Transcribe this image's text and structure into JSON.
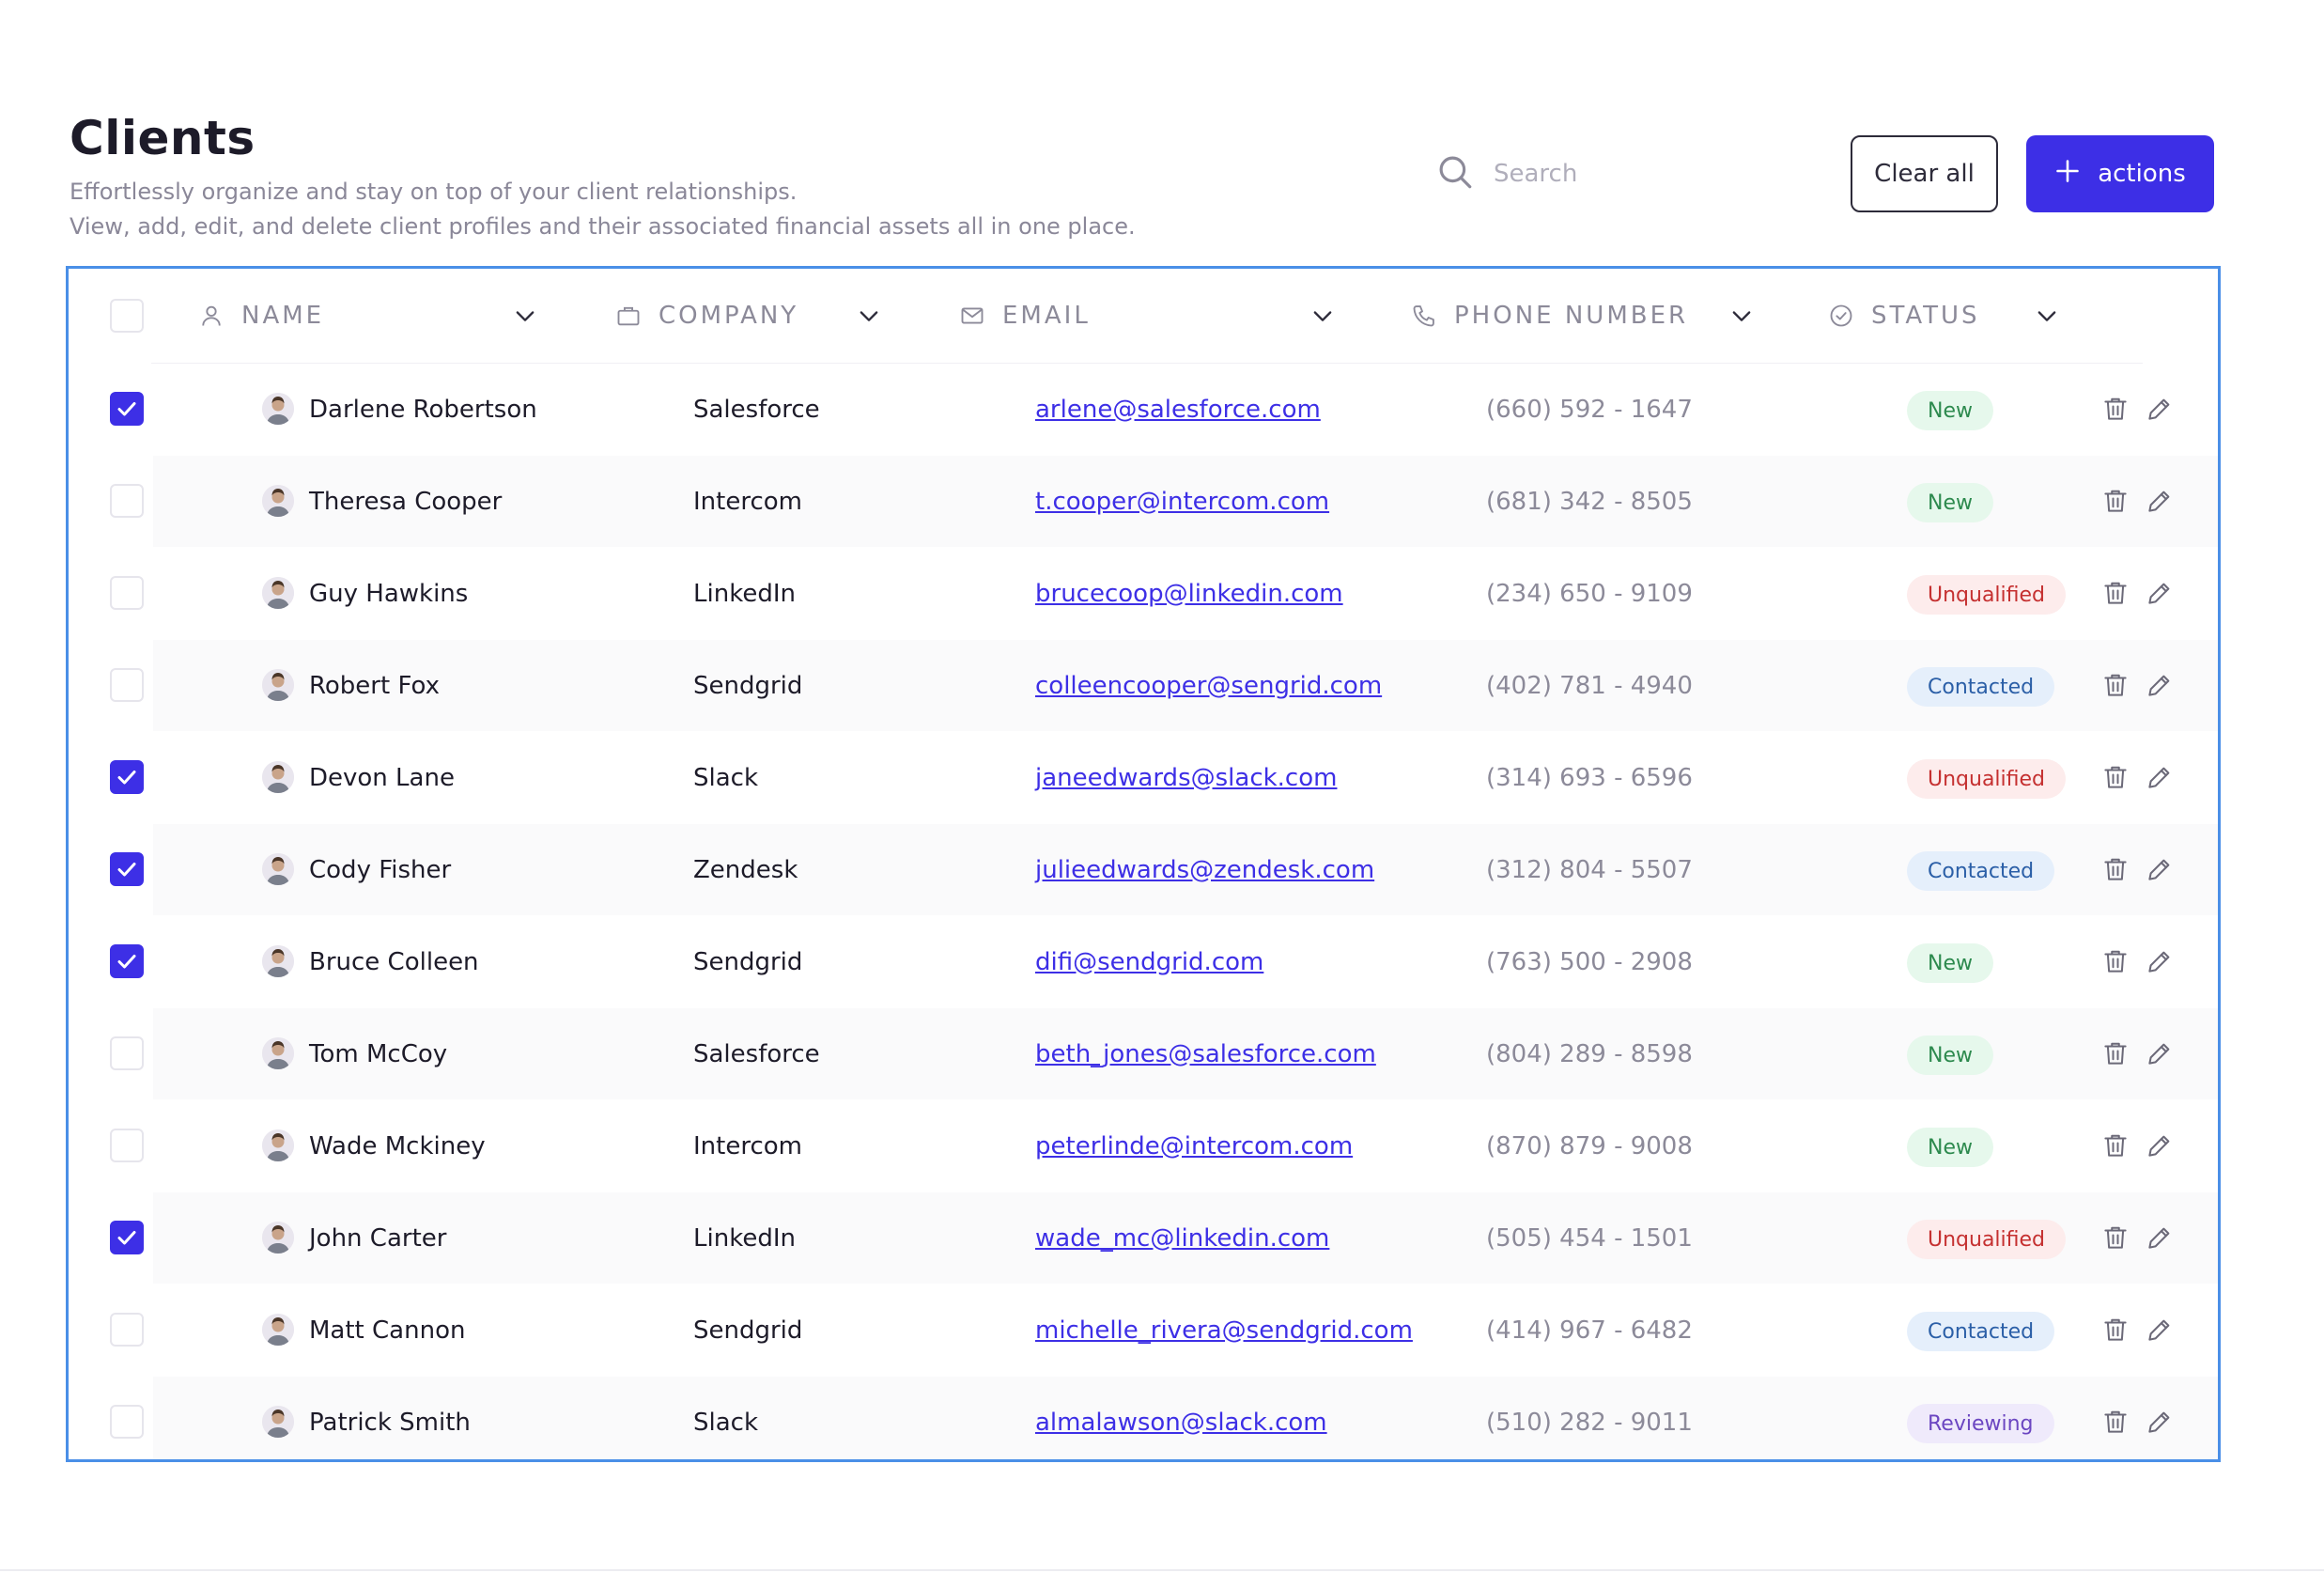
{
  "header": {
    "title": "Clients",
    "subtitle_line1": "Effortlessly organize and stay on top of your client relationships.",
    "subtitle_line2": "View, add, edit, and delete client profiles and their associated financial assets all in one place."
  },
  "search": {
    "placeholder": "Search",
    "value": ""
  },
  "buttons": {
    "clear_all": "Clear all",
    "actions": "actions"
  },
  "columns": [
    {
      "label": "NAME",
      "icon": "user-icon"
    },
    {
      "label": "COMPANY",
      "icon": "briefcase-icon"
    },
    {
      "label": "EMAIL",
      "icon": "mail-icon"
    },
    {
      "label": "PHONE NUMBER",
      "icon": "phone-icon"
    },
    {
      "label": "STATUS",
      "icon": "check-circle-icon"
    }
  ],
  "status_colors": {
    "New": "#2d8a4e",
    "Unqualified": "#c53030",
    "Contacted": "#2b5fa7",
    "Reviewing": "#6b46c1"
  },
  "accent": "#3d2fe6",
  "rows": [
    {
      "checked": true,
      "name": "Darlene Robertson",
      "company": "Salesforce",
      "email": "arlene@salesforce.com",
      "phone": "(660) 592 - 1647",
      "status": "New"
    },
    {
      "checked": false,
      "name": "Theresa Cooper",
      "company": "Intercom",
      "email": "t.cooper@intercom.com",
      "phone": "(681) 342 - 8505",
      "status": "New"
    },
    {
      "checked": false,
      "name": "Guy Hawkins",
      "company": "LinkedIn",
      "email": "brucecoop@linkedin.com",
      "phone": "(234) 650 - 9109",
      "status": "Unqualified"
    },
    {
      "checked": false,
      "name": "Robert Fox",
      "company": "Sendgrid",
      "email": "colleencooper@sengrid.com",
      "phone": "(402) 781 - 4940",
      "status": "Contacted"
    },
    {
      "checked": true,
      "name": "Devon Lane",
      "company": "Slack",
      "email": "janeedwards@slack.com",
      "phone": "(314) 693 - 6596",
      "status": "Unqualified"
    },
    {
      "checked": true,
      "name": "Cody Fisher",
      "company": "Zendesk",
      "email": "julieedwards@zendesk.com",
      "phone": "(312) 804 - 5507",
      "status": "Contacted"
    },
    {
      "checked": true,
      "name": "Bruce Colleen",
      "company": "Sendgrid",
      "email": "difi@sendgrid.com",
      "phone": "(763) 500 - 2908",
      "status": "New"
    },
    {
      "checked": false,
      "name": "Tom McCoy",
      "company": "Salesforce",
      "email": "beth_jones@salesforce.com",
      "phone": "(804) 289 - 8598",
      "status": "New"
    },
    {
      "checked": false,
      "name": "Wade Mckiney",
      "company": "Intercom",
      "email": "peterlinde@intercom.com",
      "phone": "(870) 879 - 9008",
      "status": "New"
    },
    {
      "checked": true,
      "name": "John Carter",
      "company": "LinkedIn",
      "email": "wade_mc@linkedin.com",
      "phone": "(505) 454 - 1501",
      "status": "Unqualified"
    },
    {
      "checked": false,
      "name": "Matt Cannon",
      "company": "Sendgrid",
      "email": "michelle_rivera@sendgrid.com",
      "phone": "(414) 967 - 6482",
      "status": "Contacted"
    },
    {
      "checked": false,
      "name": "Patrick Smith",
      "company": "Slack",
      "email": "almalawson@slack.com",
      "phone": "(510) 282 - 9011",
      "status": "Reviewing"
    }
  ]
}
